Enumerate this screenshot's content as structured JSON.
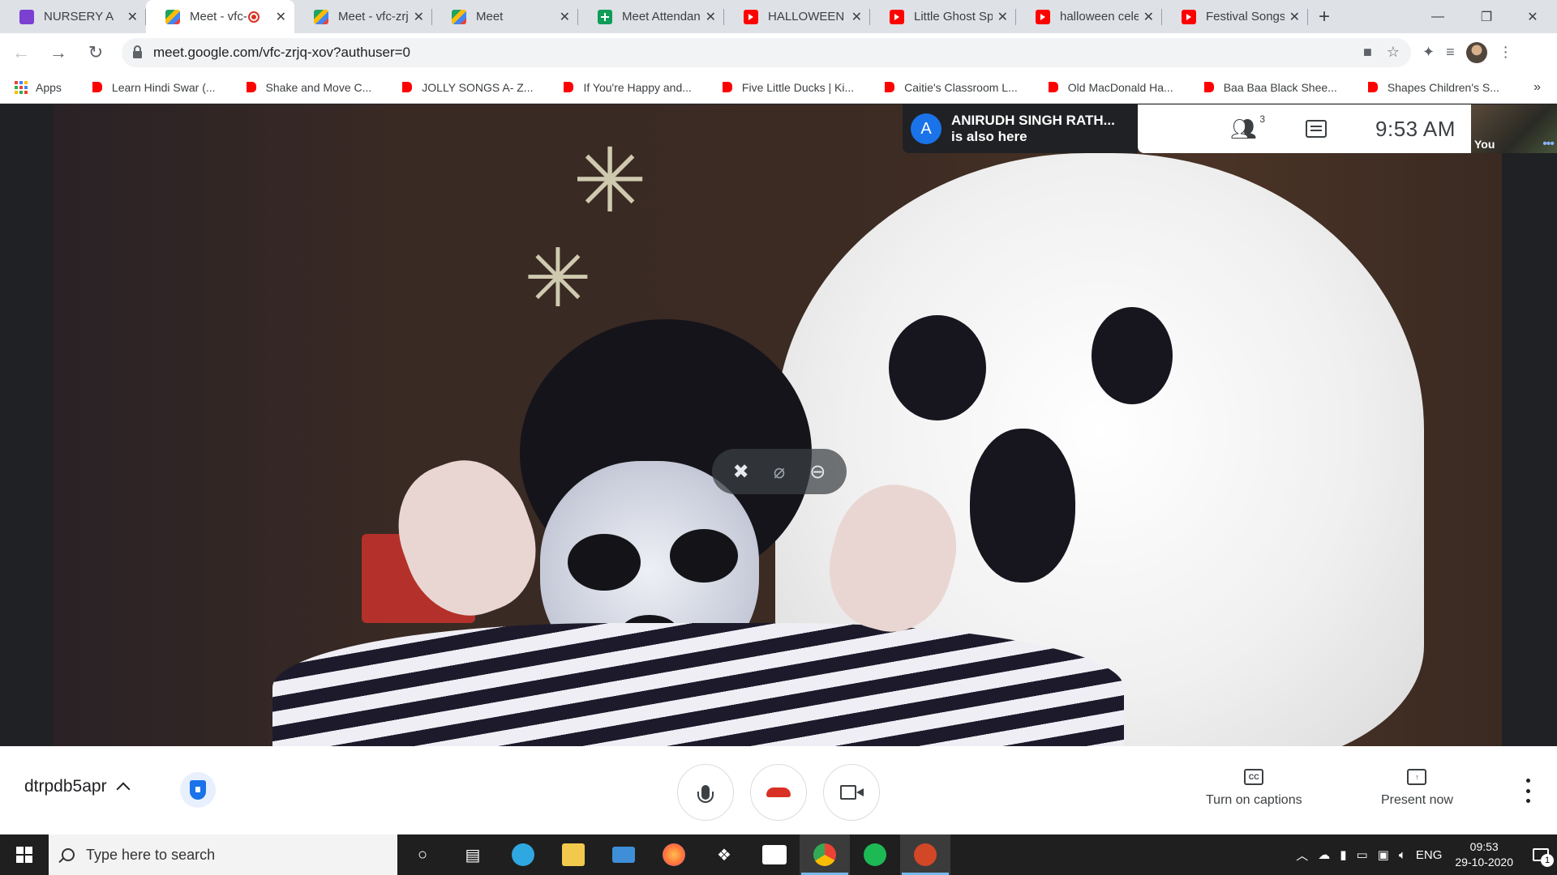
{
  "tabs": [
    {
      "title": "NURSERY A",
      "favicon": "classroom-icon",
      "active": false,
      "recording": false
    },
    {
      "title": "Meet - vfc-",
      "favicon": "meet-icon",
      "active": true,
      "recording": true
    },
    {
      "title": "Meet - vfc-zrjq",
      "favicon": "meet-icon",
      "active": false,
      "recording": false
    },
    {
      "title": "Meet",
      "favicon": "meet-icon",
      "active": false,
      "recording": false
    },
    {
      "title": "Meet Attendan",
      "favicon": "sheets-icon",
      "active": false,
      "recording": false
    },
    {
      "title": "HALLOWEEN S",
      "favicon": "youtube-icon",
      "active": false,
      "recording": false
    },
    {
      "title": "Little Ghost Sp",
      "favicon": "youtube-icon",
      "active": false,
      "recording": false
    },
    {
      "title": "halloween cele",
      "favicon": "youtube-icon",
      "active": false,
      "recording": false
    },
    {
      "title": "Festival Songs",
      "favicon": "youtube-icon",
      "active": false,
      "recording": false
    }
  ],
  "address_bar": {
    "url": "meet.google.com/vfc-zrjq-xov?authuser=0"
  },
  "bookmarks": {
    "apps_label": "Apps",
    "items": [
      "Learn Hindi Swar (...",
      "Shake and Move C...",
      "JOLLY SONGS A- Z...",
      "If You're Happy and...",
      "Five Little Ducks | Ki...",
      "Caitie's Classroom L...",
      "Old MacDonald Ha...",
      "Baa Baa Black Shee...",
      "Shapes Children's S..."
    ],
    "overflow": "»"
  },
  "meet": {
    "notification": {
      "avatar_letter": "A",
      "name": "ANIRUDH SINGH RATH...",
      "message": "is also here"
    },
    "participant_count": "3",
    "time": "9:53  AM",
    "self_label": "You",
    "meeting_code": "dtrpdb5apr",
    "captions_label": "Turn on captions",
    "captions_icon_text": "CC",
    "present_label": "Present now"
  },
  "taskbar": {
    "search_placeholder": "Type here to search",
    "language": "ENG",
    "time": "09:53",
    "date": "29-10-2020",
    "notification_count": "1",
    "apps": [
      {
        "name": "task-view-icon",
        "color": "#ffffff"
      },
      {
        "name": "timeline-icon",
        "color": "#ffffff"
      },
      {
        "name": "edge-icon",
        "color": "#2fa7e0"
      },
      {
        "name": "file-explorer-icon",
        "color": "#f2c94c"
      },
      {
        "name": "mail-icon",
        "color": "#3f8ed8"
      },
      {
        "name": "firefox-icon",
        "color": "#ff7139"
      },
      {
        "name": "dropbox-icon",
        "color": "#ffffff"
      },
      {
        "name": "amazon-icon",
        "color": "#ffffff"
      },
      {
        "name": "chrome-icon",
        "color": "#4285f4"
      },
      {
        "name": "spotify-icon",
        "color": "#1db954"
      },
      {
        "name": "powerpoint-icon",
        "color": "#d24726"
      }
    ]
  },
  "colors": {
    "meet_blue": "#1a73e8",
    "hangup_red": "#d93025",
    "youtube_red": "#ff0000"
  }
}
